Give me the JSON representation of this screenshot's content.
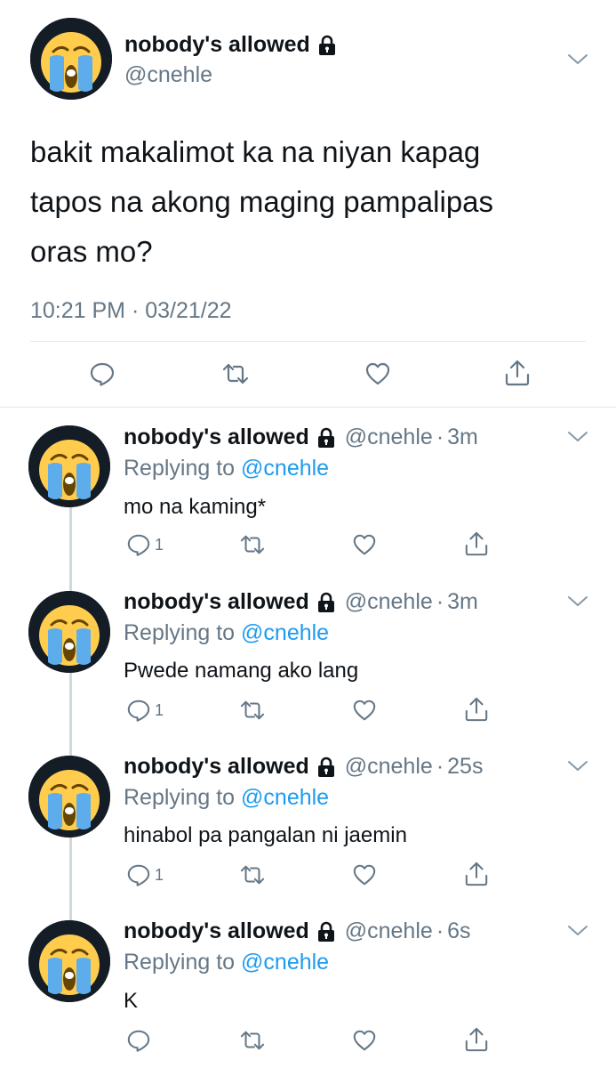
{
  "main_tweet": {
    "name": "nobody's allowed",
    "handle": "@cnehle",
    "text_lines": [
      "bakit makalimot ka na niyan kapag",
      "tapos na akong maging pampalipas",
      "oras mo?"
    ],
    "timestamp": "10:21 PM · 03/21/22"
  },
  "replies": [
    {
      "name": "nobody's allowed",
      "handle": "@cnehle",
      "dot": "·",
      "time": "3m",
      "replying_label": "Replying to",
      "replying_to": "@cnehle",
      "text": "mo na kaming*",
      "reply_count": "1"
    },
    {
      "name": "nobody's allowed",
      "handle": "@cnehle",
      "dot": "·",
      "time": "3m",
      "replying_label": "Replying to",
      "replying_to": "@cnehle",
      "text": "Pwede namang ako lang",
      "reply_count": "1"
    },
    {
      "name": "nobody's allowed",
      "handle": "@cnehle",
      "dot": "·",
      "time": "25s",
      "replying_label": "Replying to",
      "replying_to": "@cnehle",
      "text": "hinabol pa pangalan ni jaemin",
      "reply_count": "1"
    },
    {
      "name": "nobody's allowed",
      "handle": "@cnehle",
      "dot": "·",
      "time": "6s",
      "replying_label": "Replying to",
      "replying_to": "@cnehle",
      "text": "K",
      "reply_count": ""
    }
  ],
  "icons": {
    "avatar": "loudly-crying-face-emoji",
    "lock": "lock-icon",
    "chevron": "chevron-down-icon",
    "reply": "reply-icon",
    "retweet": "retweet-icon",
    "like": "heart-icon",
    "share": "share-icon"
  },
  "colors": {
    "link": "#1d9bf0",
    "secondary": "#657786",
    "text": "#0f1419",
    "avatar_bg": "#141d26"
  }
}
